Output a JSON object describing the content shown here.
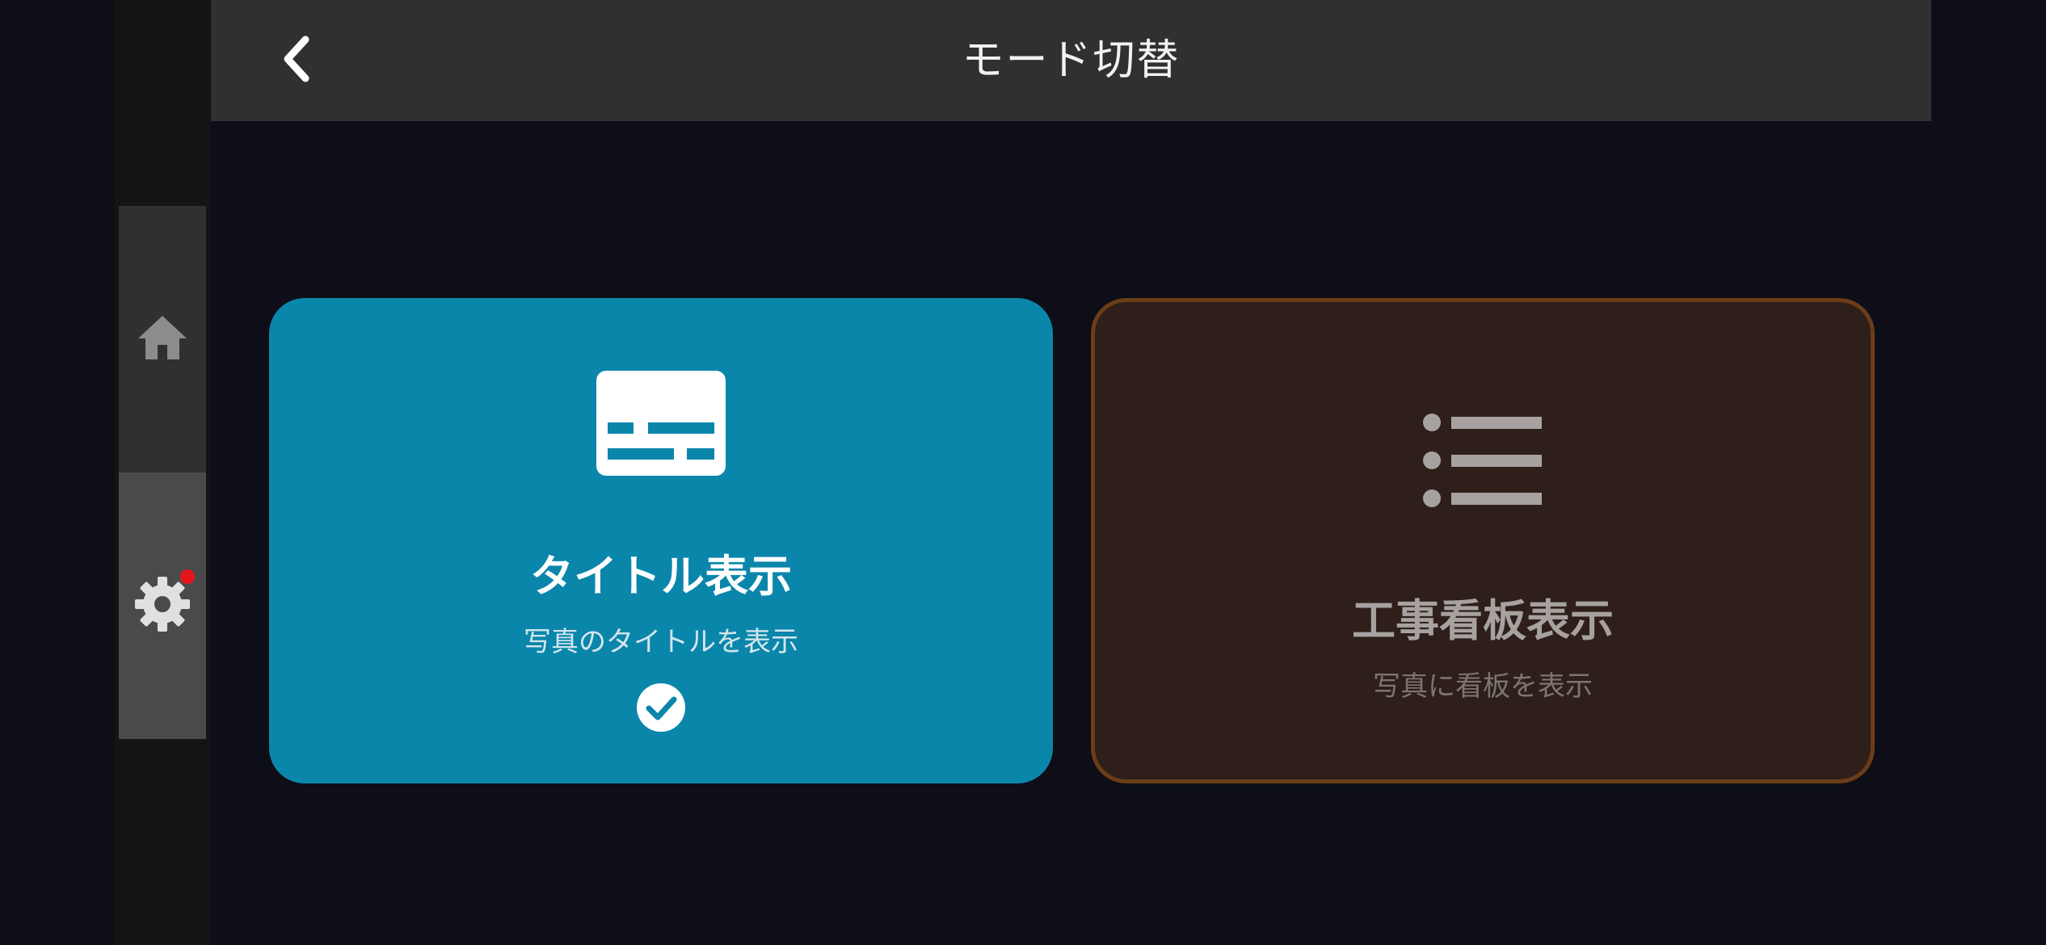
{
  "header": {
    "title": "モード切替"
  },
  "rail": {
    "items": [
      {
        "icon": "home-icon"
      },
      {
        "icon": "gear-icon",
        "badge": true
      }
    ],
    "badge_color": "#e8141c"
  },
  "modes": [
    {
      "label": "タイトル表示",
      "description": "写真のタイトルを表示",
      "icon": "subtitles-icon",
      "selected": true,
      "color": "#0b86ab"
    },
    {
      "label": "工事看板表示",
      "description": "写真に看板を表示",
      "icon": "list-icon",
      "selected": false,
      "color": "#2e1f1a",
      "border_color": "#6b3d18"
    }
  ]
}
